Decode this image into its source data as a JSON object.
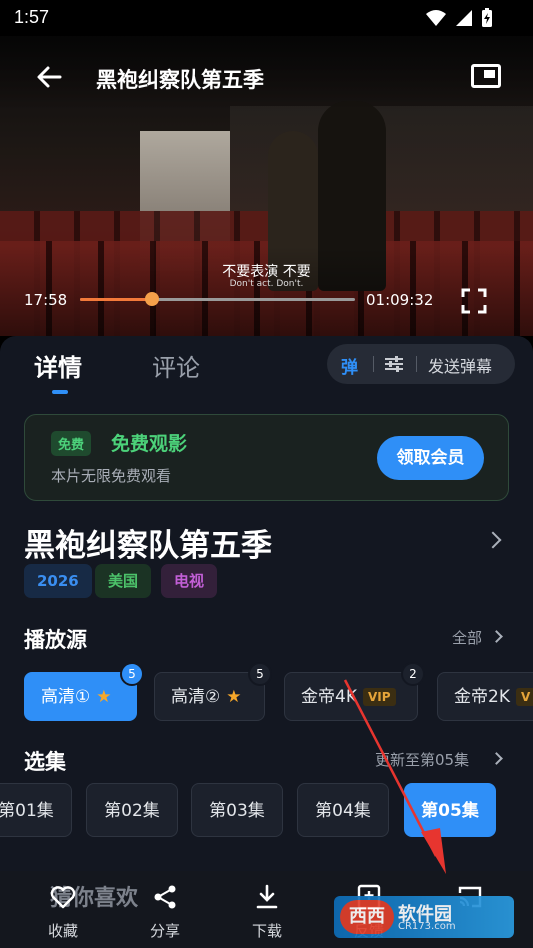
{
  "status_bar": {
    "time": "1:57"
  },
  "player": {
    "title": "黑袍纠察队第五季",
    "subtitle_cn": "不要表演  不要",
    "subtitle_en": "Don't act. Don't.",
    "current_time": "17:58",
    "duration": "01:09:32",
    "progress": 0.26
  },
  "tabs": {
    "detail": "详情",
    "comments": "评论"
  },
  "danmu": {
    "toggle": "弹",
    "send": "发送弹幕"
  },
  "promo": {
    "badge": "免费",
    "title": "免费观影",
    "desc": "本片无限免费观看",
    "button": "领取会员"
  },
  "show": {
    "title": "黑袍纠察队第五季",
    "tags": [
      {
        "text": "2026",
        "color": "#3a8ef0",
        "bg": "#172a45"
      },
      {
        "text": "美国",
        "color": "#4cc26a",
        "bg": "#1b3324"
      },
      {
        "text": "电视",
        "color": "#c25fd6",
        "bg": "#33203a"
      }
    ]
  },
  "sources": {
    "heading": "播放源",
    "all_link": "全部",
    "items": [
      {
        "label": "高清①",
        "star": "★",
        "count": "5"
      },
      {
        "label": "高清②",
        "star": "★",
        "count": "5"
      },
      {
        "label": "金帝4K",
        "vip": "VIP",
        "count": "2"
      },
      {
        "label": "金帝2K",
        "vip": "V"
      }
    ]
  },
  "episodes": {
    "heading": "选集",
    "update_link": "更新至第05集",
    "items": [
      "第01集",
      "第02集",
      "第03集",
      "第04集",
      "第05集"
    ]
  },
  "bottom": {
    "guess": "猜你喜欢",
    "favorite": "收藏",
    "share": "分享",
    "download": "下载",
    "feedback": "反馈"
  },
  "watermark": {
    "title": "软件园",
    "site": "CR173.com",
    "logo": "西西"
  },
  "colors": {
    "accent": "#2f8ff7",
    "green": "#4cd27a",
    "progress": "#f37a3a"
  }
}
